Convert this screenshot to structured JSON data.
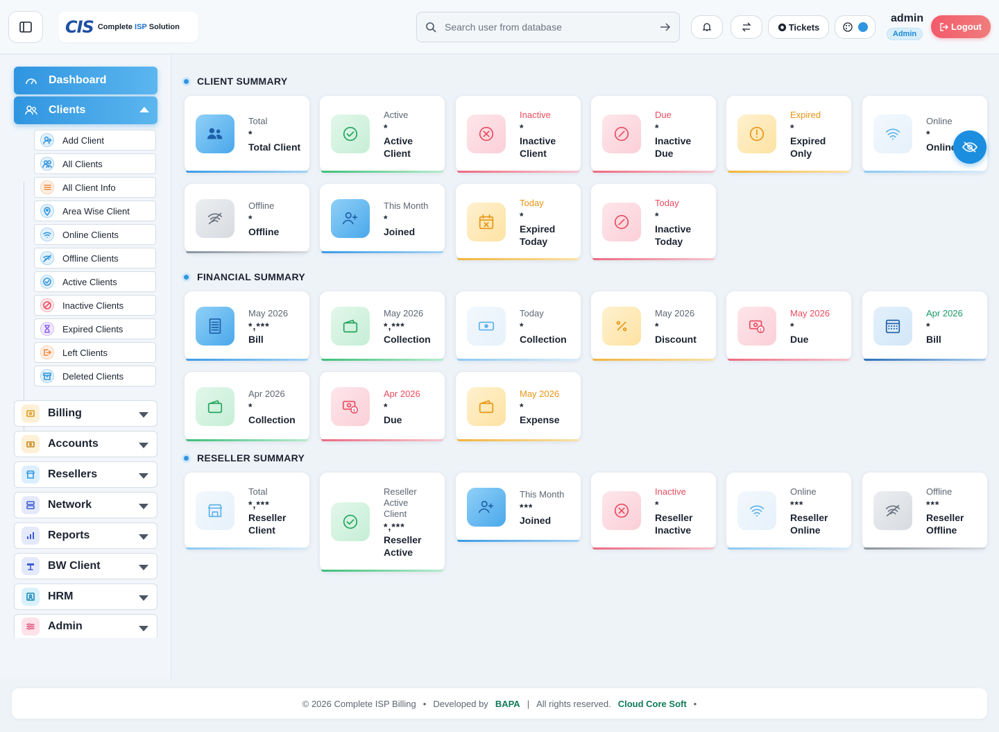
{
  "header": {
    "logo_mark": "CIS",
    "logo_text_a": "Complete ",
    "logo_text_b": "ISP",
    "logo_text_c": " Solution",
    "search_placeholder": "Search user from database",
    "tickets_label": "Tickets",
    "user_name": "admin",
    "user_role": "Admin",
    "logout_label": "Logout"
  },
  "sidebar": {
    "dashboard": "Dashboard",
    "clients": "Clients",
    "client_sub": [
      {
        "label": "Add Client",
        "icon": "add-user-icon",
        "color": "#2f95e0"
      },
      {
        "label": "All Clients",
        "icon": "users-icon",
        "color": "#2f95e0"
      },
      {
        "label": "All Client Info",
        "icon": "list-icon",
        "color": "#f08a3c"
      },
      {
        "label": "Area Wise Client",
        "icon": "location-icon",
        "color": "#2f95e0"
      },
      {
        "label": "Online Clients",
        "icon": "wifi-icon",
        "color": "#2f95e0"
      },
      {
        "label": "Offline Clients",
        "icon": "wifi-off-icon",
        "color": "#2f95e0"
      },
      {
        "label": "Active Clients",
        "icon": "check-icon",
        "color": "#2f95e0"
      },
      {
        "label": "Inactive Clients",
        "icon": "ban-icon",
        "color": "#e84a5f"
      },
      {
        "label": "Expired Clients",
        "icon": "hourglass-icon",
        "color": "#8b5cf6"
      },
      {
        "label": "Left Clients",
        "icon": "exit-icon",
        "color": "#f08a3c"
      },
      {
        "label": "Deleted Clients",
        "icon": "archive-icon",
        "color": "#2f95e0"
      }
    ],
    "groups": [
      {
        "label": "Billing",
        "icon": "billing-icon",
        "bg": "#fdf0d5",
        "color": "#d99a1e"
      },
      {
        "label": "Accounts",
        "icon": "wallet-icon",
        "bg": "#fdf0d5",
        "color": "#c7821a"
      },
      {
        "label": "Resellers",
        "icon": "store-icon",
        "bg": "#dcefff",
        "color": "#2f95e0"
      },
      {
        "label": "Network",
        "icon": "server-icon",
        "bg": "#e4e9fb",
        "color": "#3b5bd6"
      },
      {
        "label": "Reports",
        "icon": "chart-icon",
        "bg": "#e4e9fb",
        "color": "#3b5bd6"
      },
      {
        "label": "BW Client",
        "icon": "bandwidth-icon",
        "bg": "#e4e9fb",
        "color": "#3b5bd6"
      },
      {
        "label": "HRM",
        "icon": "id-card-icon",
        "bg": "#d9f1fa",
        "color": "#1c8ab8"
      },
      {
        "label": "Admin",
        "icon": "sliders-icon",
        "bg": "#fde2ea",
        "color": "#e0527a"
      }
    ]
  },
  "sections": {
    "client": "CLIENT SUMMARY",
    "financial": "FINANCIAL SUMMARY",
    "reseller": "RESELLER SUMMARY"
  },
  "client_cards": [
    {
      "l1": "Total",
      "l1_color": "#5d6672",
      "l2": "*",
      "l3": "Total Client",
      "icon": "users-icon",
      "theme": "blue"
    },
    {
      "l1": "Active",
      "l1_color": "#5d6672",
      "l2": "*",
      "l3": "Active Client",
      "icon": "check-icon",
      "theme": "green"
    },
    {
      "l1": "Inactive",
      "l1_color": "#e84a5f",
      "l2": "*",
      "l3": "Inactive Client",
      "icon": "x-circle-icon",
      "theme": "pink"
    },
    {
      "l1": "Due",
      "l1_color": "#e84a5f",
      "l2": "*",
      "l3": "Inactive Due",
      "icon": "ban-icon",
      "theme": "pink"
    },
    {
      "l1": "Expired",
      "l1_color": "#e89415",
      "l2": "*",
      "l3": "Expired Only",
      "icon": "alert-icon",
      "theme": "yellow"
    },
    {
      "l1": "Online",
      "l1_color": "#5d6672",
      "l2": "*",
      "l3": "Online",
      "icon": "wifi-icon",
      "theme": "lightblue"
    },
    {
      "l1": "Offline",
      "l1_color": "#5d6672",
      "l2": "*",
      "l3": "Offline",
      "icon": "wifi-off-icon",
      "theme": "gray"
    },
    {
      "l1": "This Month",
      "l1_color": "#5d6672",
      "l2": "*",
      "l3": "Joined",
      "icon": "add-user-icon",
      "theme": "blue"
    },
    {
      "l1": "Today",
      "l1_color": "#e89415",
      "l2": "*",
      "l3": "Expired Today",
      "icon": "calendar-x-icon",
      "theme": "yellow"
    },
    {
      "l1": "Today",
      "l1_color": "#e84a5f",
      "l2": "*",
      "l3": "Inactive Today",
      "icon": "ban-icon",
      "theme": "pink"
    }
  ],
  "financial_cards": [
    {
      "l1": "May 2026",
      "l1_color": "#5d6672",
      "l2": "*,***",
      "l3": "Bill",
      "icon": "receipt-icon",
      "theme": "blue"
    },
    {
      "l1": "May 2026",
      "l1_color": "#5d6672",
      "l2": "*,***",
      "l3": "Collection",
      "icon": "wallet-icon",
      "theme": "green"
    },
    {
      "l1": "Today",
      "l1_color": "#5d6672",
      "l2": "*",
      "l3": "Collection",
      "icon": "cash-icon",
      "theme": "lightblue"
    },
    {
      "l1": "May 2026",
      "l1_color": "#5d6672",
      "l2": "*",
      "l3": "Discount",
      "icon": "percent-icon",
      "theme": "yellow"
    },
    {
      "l1": "May 2026",
      "l1_color": "#e84a5f",
      "l2": "*",
      "l3": "Due",
      "icon": "money-due-icon",
      "theme": "pink"
    },
    {
      "l1": "Apr 2026",
      "l1_color": "#1a9a68",
      "l2": "*",
      "l3": "Bill",
      "icon": "calendar-grid-icon",
      "theme": "navy"
    },
    {
      "l1": "Apr 2026",
      "l1_color": "#5d6672",
      "l2": "*",
      "l3": "Collection",
      "icon": "wallet-icon",
      "theme": "green"
    },
    {
      "l1": "Apr 2026",
      "l1_color": "#e84a5f",
      "l2": "*",
      "l3": "Due",
      "icon": "money-due-icon",
      "theme": "pink"
    },
    {
      "l1": "May 2026",
      "l1_color": "#e89415",
      "l2": "*",
      "l3": "Expense",
      "icon": "wallet-icon",
      "theme": "yellow"
    }
  ],
  "reseller_cards": [
    {
      "l1": "Total",
      "l1_color": "#5d6672",
      "l2": "*,***",
      "l3": "Reseller Client",
      "icon": "store-icon",
      "theme": "lightblue"
    },
    {
      "l1": "Reseller Active Client",
      "l1_color": "#5d6672",
      "l2": "*,***",
      "l3": "Reseller Active",
      "icon": "check-icon",
      "theme": "green"
    },
    {
      "l1": "This Month",
      "l1_color": "#5d6672",
      "l2": "***",
      "l3": "Joined",
      "icon": "add-user-icon",
      "theme": "blue"
    },
    {
      "l1": "Inactive",
      "l1_color": "#e84a5f",
      "l2": "*",
      "l3": "Reseller Inactive",
      "icon": "x-circle-icon",
      "theme": "pink"
    },
    {
      "l1": "Online",
      "l1_color": "#5d6672",
      "l2": "***",
      "l3": "Reseller Online",
      "icon": "wifi-icon",
      "theme": "lightblue"
    },
    {
      "l1": "Offline",
      "l1_color": "#5d6672",
      "l2": "***",
      "l3": "Reseller Offline",
      "icon": "wifi-off-icon",
      "theme": "gray"
    }
  ],
  "footer": {
    "copyright": "© 2026 Complete ISP Billing",
    "dev_by": "Developed by",
    "dev_brand": "BAPA",
    "rights": "All rights reserved.",
    "company": "Cloud Core Soft"
  },
  "colors": {
    "accent": "#2f95e0",
    "logout": "#f25b6b"
  }
}
